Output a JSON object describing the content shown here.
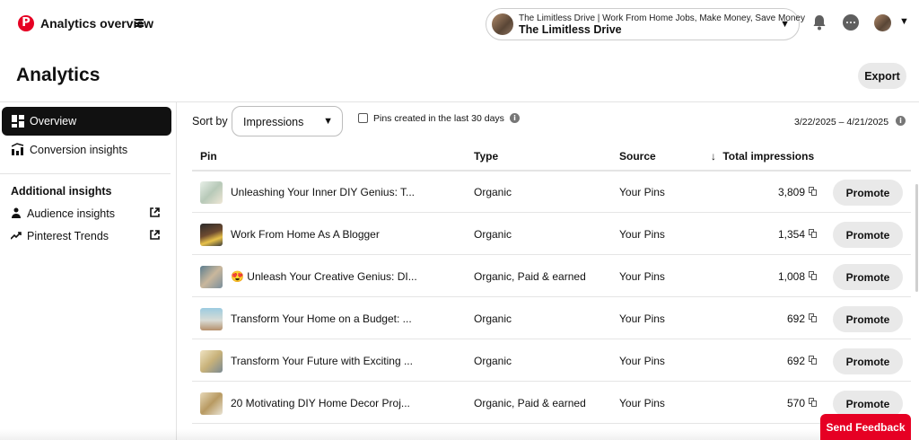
{
  "header": {
    "app_title": "Analytics overview",
    "account_sub": "The Limitless Drive | Work From Home Jobs, Make Money, Save Money",
    "account_name": "The Limitless Drive"
  },
  "page": {
    "title": "Analytics",
    "export_label": "Export"
  },
  "sidebar": {
    "overview": "Overview",
    "conversion": "Conversion insights",
    "additional_heading": "Additional insights",
    "links": [
      "Audience insights",
      "Pinterest Trends"
    ]
  },
  "filters": {
    "sort_by_label": "Sort by",
    "sort_value": "Impressions",
    "checkbox_label": "Pins created in the last 30 days",
    "date_range": "3/22/2025 – 4/21/2025"
  },
  "table": {
    "columns": [
      "Pin",
      "Type",
      "Source",
      "Total impressions"
    ],
    "promote_label": "Promote",
    "rows": [
      {
        "title": "Unleashing Your Inner DIY Genius: T...",
        "type": "Organic",
        "source": "Your Pins",
        "impressions": "3,809"
      },
      {
        "title": "Work From Home As A Blogger",
        "type": "Organic",
        "source": "Your Pins",
        "impressions": "1,354"
      },
      {
        "title": "😍 Unleash Your Creative Genius: DI...",
        "type": "Organic, Paid & earned",
        "source": "Your Pins",
        "impressions": "1,008"
      },
      {
        "title": "Transform Your Home on a Budget: ...",
        "type": "Organic",
        "source": "Your Pins",
        "impressions": "692"
      },
      {
        "title": "Transform Your Future with Exciting ...",
        "type": "Organic",
        "source": "Your Pins",
        "impressions": "692"
      },
      {
        "title": "20 Motivating DIY Home Decor Proj...",
        "type": "Organic, Paid & earned",
        "source": "Your Pins",
        "impressions": "570"
      }
    ]
  },
  "feedback_label": "Send Feedback",
  "colors": {
    "brand": "#e60023",
    "nav_active": "#111111",
    "button_bg": "#e9e9e9"
  }
}
